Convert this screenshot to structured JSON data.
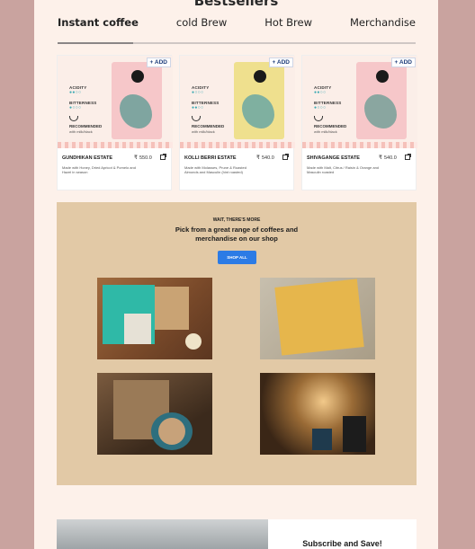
{
  "section": {
    "title": "Bestsellers"
  },
  "tabs": [
    {
      "label": "Instant coffee",
      "active": true
    },
    {
      "label": "cold Brew",
      "active": false
    },
    {
      "label": "Hot Brew",
      "active": false
    },
    {
      "label": "Merchandise",
      "active": false
    }
  ],
  "products": [
    {
      "add_label": "+ ADD",
      "acidity": "ACIDITY",
      "bitterness": "BITTERNESS",
      "recommended": "RECOMMENDED",
      "recommended_sub": "with milk/black",
      "acidity_dots": "●●○○",
      "bitterness_dots": "●○○○",
      "name": "GUNDHIKAN ESTATE",
      "price": "550.0",
      "description": "Made with Honey, Dried Apricot & Pomelo and Hazel in season",
      "bag_color": "#f6c7c9",
      "leaf_color": "#7fa5a0"
    },
    {
      "add_label": "+ ADD",
      "acidity": "ACIDITY",
      "bitterness": "BITTERNESS",
      "recommended": "RECOMMENDED",
      "recommended_sub": "with milk/black",
      "acidity_dots": "●○○○",
      "bitterness_dots": "●●○○",
      "name": "KOLLI BERRI ESTATE",
      "price": "540.0",
      "description": "Made with Molasses, Prune & Roasted Almonds and Masculin (hint roasted)",
      "bag_color": "#efe08e",
      "leaf_color": "#7fb0a0"
    },
    {
      "add_label": "+ ADD",
      "acidity": "ACIDITY",
      "bitterness": "BITTERNESS",
      "recommended": "RECOMMENDED",
      "recommended_sub": "with milk/black",
      "acidity_dots": "●●○○",
      "bitterness_dots": "●○○○",
      "name": "SHIVAGANGE ESTATE",
      "price": "540.0",
      "description": "Made with Malt, Citrus / Raisin & Orange and Masculin roasted",
      "bag_color": "#f6c7c9",
      "leaf_color": "#8aa6a0"
    }
  ],
  "promo": {
    "kicker": "WAIT, THERE'S MORE",
    "headline": "Pick from a great range of coffees and merchandise on our shop",
    "button": "SHOP ALL"
  },
  "subscribe": {
    "title": "Subscribe and Save!"
  }
}
